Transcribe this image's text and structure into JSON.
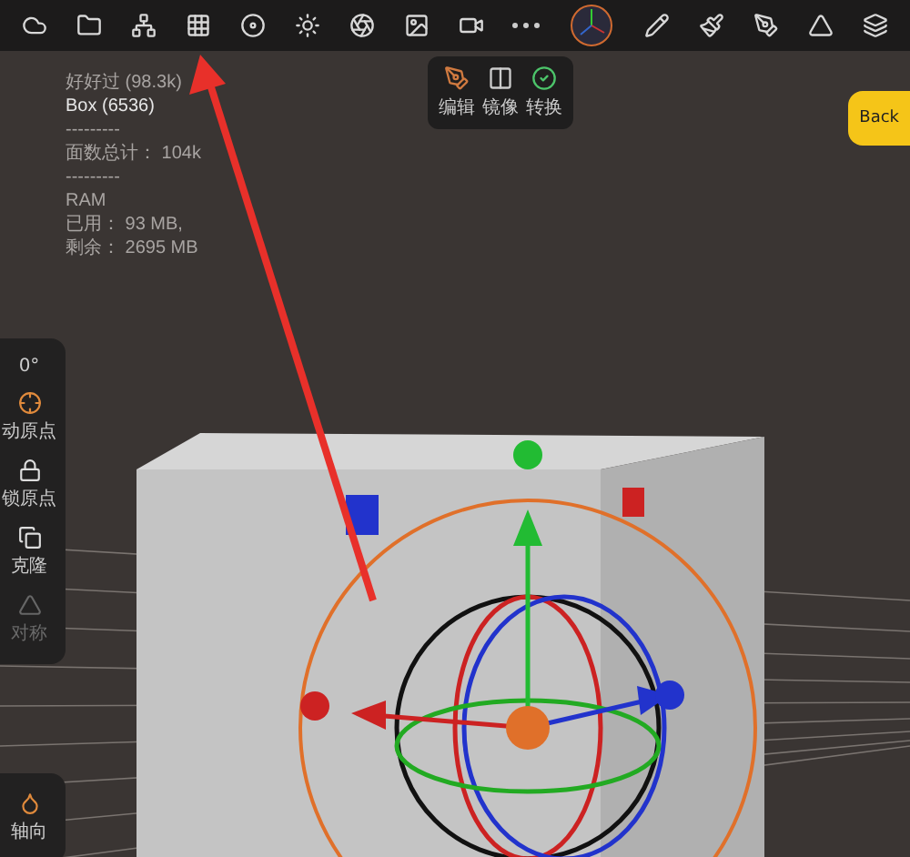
{
  "stats": [
    {
      "text": "好好过 (98.3k)",
      "kind": "dim"
    },
    {
      "text": "Box (6536)",
      "kind": "bright"
    },
    {
      "text": "---------",
      "kind": "dim"
    },
    {
      "text": "面数总计： 104k",
      "kind": "dim"
    },
    {
      "text": "---------",
      "kind": "dim"
    },
    {
      "text": "RAM",
      "kind": "dim"
    },
    {
      "text": "已用： 93 MB,",
      "kind": "dim"
    },
    {
      "text": "剩余： 2695 MB",
      "kind": "dim"
    }
  ],
  "popup": [
    {
      "label": "编辑",
      "selected": false
    },
    {
      "label": "镜像",
      "selected": false
    },
    {
      "label": "转换",
      "selected": true
    }
  ],
  "back_button": "Back",
  "side_panel": [
    {
      "kind": "reading",
      "label": "0°",
      "disabled": false
    },
    {
      "kind": "target",
      "label": "动原点",
      "disabled": false
    },
    {
      "kind": "lock",
      "label": "锁原点",
      "disabled": false
    },
    {
      "kind": "clone",
      "label": "克隆",
      "disabled": false
    },
    {
      "kind": "mirror",
      "label": "对称",
      "disabled": true
    }
  ],
  "side_panel_2": [
    {
      "kind": "drop",
      "label": "轴向",
      "disabled": false
    }
  ]
}
